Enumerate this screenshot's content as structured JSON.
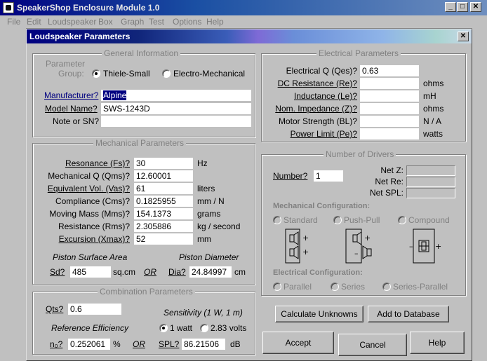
{
  "app": {
    "title": "SpeakerShop Enclosure Module 1.0"
  },
  "menu": [
    "File",
    "Edit",
    "Loudspeaker",
    "Box",
    "Graph",
    "Test",
    "Options",
    "Help"
  ],
  "dialog": {
    "title": "Loudspeaker Parameters"
  },
  "general": {
    "group_label": "General Information",
    "param_group_label_1": "Parameter",
    "param_group_label_2": "Group:",
    "option_ts": "Thiele-Small",
    "option_em": "Electro-Mechanical",
    "manufacturer_label": "Manufacturer?",
    "manufacturer_value": "Alpine",
    "model_label": "Model Name?",
    "model_value": "SWS-1243D",
    "note_label": "Note or SN?",
    "note_value": ""
  },
  "mechanical": {
    "group_label": "Mechanical Parameters",
    "rows": [
      {
        "label": "Resonance (Fs)?",
        "value": "30",
        "unit": "Hz"
      },
      {
        "label": "Mechanical Q (Qms)?",
        "value": "12.60001",
        "unit": ""
      },
      {
        "label": "Equivalent Vol. (Vas)?",
        "value": "61",
        "unit": "liters"
      },
      {
        "label": "Compliance (Cms)?",
        "value": "0.1825955",
        "unit": "mm / N"
      },
      {
        "label": "Moving Mass (Mms)?",
        "value": "154.1373",
        "unit": "grams"
      },
      {
        "label": "Resistance (Rms)?",
        "value": "2.305886",
        "unit": "kg / second"
      },
      {
        "label": "Excursion (Xmax)?",
        "value": "52",
        "unit": "mm"
      }
    ],
    "piston_area_label": "Piston Surface Area",
    "piston_diam_label": "Piston Diameter",
    "sd_label": "Sd?",
    "sd_value": "485",
    "sd_unit": "sq.cm",
    "or_label": "OR",
    "dia_label": "Dia?",
    "dia_value": "24.84997",
    "dia_unit": "cm"
  },
  "combination": {
    "group_label": "Combination Parameters",
    "qts_label": "Qts?",
    "qts_value": "0.6",
    "sensitivity_label": "Sensitivity (1 W, 1 m)",
    "ref_eff_label": "Reference Efficiency",
    "opt_1w": "1 watt",
    "opt_283v": "2.83 volts",
    "n0_label": "n₀?",
    "n0_value": "0.252061",
    "n0_unit": "%",
    "or_label": "OR",
    "spl_label": "SPL?",
    "spl_value": "86.21506",
    "spl_unit": "dB"
  },
  "electrical": {
    "group_label": "Electrical Parameters",
    "rows": [
      {
        "label": "Electrical Q (Qes)?",
        "value": "0.63",
        "unit": ""
      },
      {
        "label": "DC Resistance (Re)?",
        "value": "",
        "unit": "ohms"
      },
      {
        "label": "Inductance (Le)?",
        "value": "",
        "unit": "mH"
      },
      {
        "label": "Nom. Impedance (Z)?",
        "value": "",
        "unit": "ohms"
      },
      {
        "label": "Motor Strength (BL)?",
        "value": "",
        "unit": "N / A"
      },
      {
        "label": "Power Limit (Pe)?",
        "value": "",
        "unit": "watts"
      }
    ]
  },
  "drivers": {
    "group_label": "Number of Drivers",
    "number_label": "Number?",
    "number_value": "1",
    "net_z_label": "Net Z:",
    "net_re_label": "Net Re:",
    "net_spl_label": "Net SPL:",
    "mech_config_label": "Mechanical Configuration:",
    "opt_standard": "Standard",
    "opt_pushpull": "Push-Pull",
    "opt_compound": "Compound",
    "elec_config_label": "Electrical Configuration:",
    "opt_parallel": "Parallel",
    "opt_series": "Series",
    "opt_series_parallel": "Series-Parallel"
  },
  "buttons": {
    "calculate": "Calculate Unknowns",
    "add_db": "Add to Database",
    "accept": "Accept",
    "cancel": "Cancel",
    "help": "Help"
  }
}
